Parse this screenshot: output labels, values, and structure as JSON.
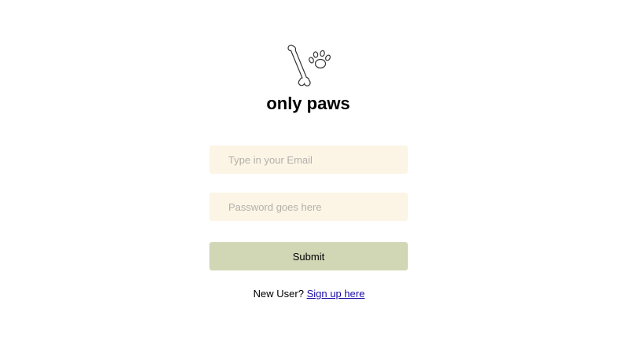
{
  "brand": {
    "logo_icon": "bone-and-paw-icon",
    "title": "only paws"
  },
  "form": {
    "email": {
      "value": "",
      "placeholder": "Type in your Email"
    },
    "password": {
      "value": "",
      "placeholder": "Password goes here"
    },
    "submit_label": "Submit"
  },
  "signup": {
    "prompt": "New User?",
    "link_label": "Sign up here"
  },
  "colors": {
    "input_background": "#fcf5e6",
    "button_background": "#d1d7b5",
    "link": "#1a0dab"
  }
}
